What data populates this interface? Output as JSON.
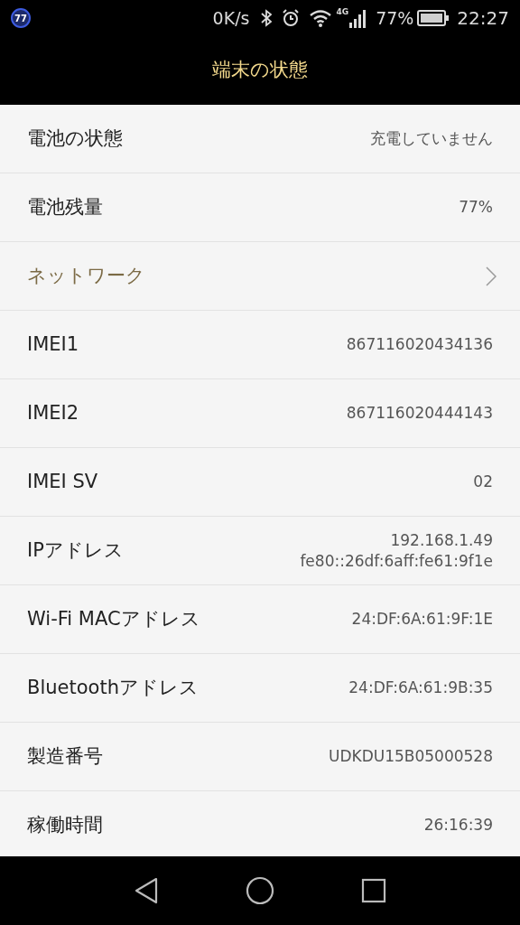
{
  "status_bar": {
    "badge": "77",
    "speed": "0K/s",
    "network_type": "4G",
    "battery": "77%",
    "time": "22:27"
  },
  "title": "端末の状態",
  "rows": [
    {
      "kind": "value",
      "label": "電池の状態",
      "values": [
        "充電していません"
      ]
    },
    {
      "kind": "value",
      "label": "電池残量",
      "values": [
        "77%"
      ]
    },
    {
      "kind": "link",
      "label": "ネットワーク"
    },
    {
      "kind": "value",
      "label": "IMEI1",
      "values": [
        "867116020434136"
      ]
    },
    {
      "kind": "value",
      "label": "IMEI2",
      "values": [
        "867116020444143"
      ]
    },
    {
      "kind": "value",
      "label": "IMEI SV",
      "values": [
        "02"
      ]
    },
    {
      "kind": "value",
      "label": "IPアドレス",
      "values": [
        "192.168.1.49",
        "fe80::26df:6aff:fe61:9f1e"
      ]
    },
    {
      "kind": "value",
      "label": "Wi-Fi MACアドレス",
      "values": [
        "24:DF:6A:61:9F:1E"
      ]
    },
    {
      "kind": "value",
      "label": "Bluetoothアドレス",
      "values": [
        "24:DF:6A:61:9B:35"
      ]
    },
    {
      "kind": "value",
      "label": "製造番号",
      "values": [
        "UDKDU15B05000528"
      ]
    },
    {
      "kind": "value",
      "label": "稼働時間",
      "values": [
        "26:16:39"
      ]
    }
  ]
}
